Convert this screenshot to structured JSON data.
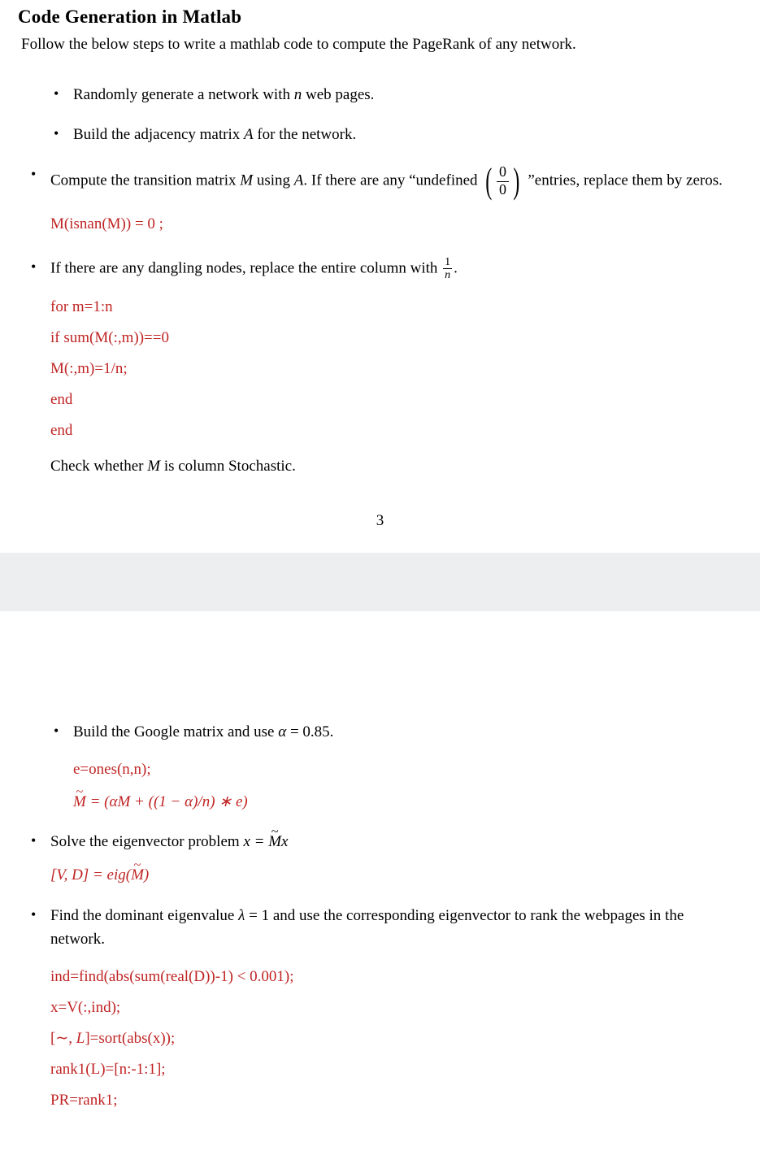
{
  "heading": "Code Generation in Matlab",
  "intro": "Follow the below steps to write a mathlab code to compute the PageRank of any network.",
  "page_number": "3",
  "page1": {
    "b1_pre": "Randomly generate a network with ",
    "b1_var": "n",
    "b1_post": " web pages.",
    "b2_pre": "Build the adjacency matrix ",
    "b2_var": "A",
    "b2_post": " for the network.",
    "b3_pre": "Compute the transition matrix ",
    "b3_M": "M",
    "b3_mid": " using ",
    "b3_A": "A",
    "b3_after": ". If there are any “undefined ",
    "b3_frac_num": "0",
    "b3_frac_den": "0",
    "b3_tail": "”entries, replace them by zeros.",
    "b3_code": "M(isnan(M)) = 0 ;",
    "b4_pre": "If there are any dangling nodes, replace the entire column with ",
    "b4_frac_num": "1",
    "b4_frac_den": "n",
    "b4_post": ".",
    "b4_code": "for m=1:n\nif sum(M(:,m))==0\nM(:,m)=1/n;\nend\nend",
    "b4_check_pre": "Check whether ",
    "b4_check_M": "M",
    "b4_check_post": " is column Stochastic."
  },
  "page2": {
    "b5_pre": "Build the Google matrix and use ",
    "b5_alpha": "α",
    "b5_eq": " = 0.85.",
    "b5_code1": "e=ones(n,n);",
    "b5_code2_pre": "M̃ = (αM + ((1 − α)/n) ∗ e)",
    "b6_pre": "Solve the eigenvector problem ",
    "b6_eq": "x = M̃x",
    "b6_code": "[V, D] = eig(M̃)",
    "b7_pre": "Find the dominant eigenvalue ",
    "b7_lambda": "λ",
    "b7_eq": " = 1 and use the corresponding eigenvector to rank the webpages in the network.",
    "b7_code": "ind=find(abs(sum(real(D))-1) < 0.001);\nx=V(:,ind);\n[∼, L]=sort(abs(x));\nrank1(L)=[n:-1:1];\nPR=rank1;"
  }
}
